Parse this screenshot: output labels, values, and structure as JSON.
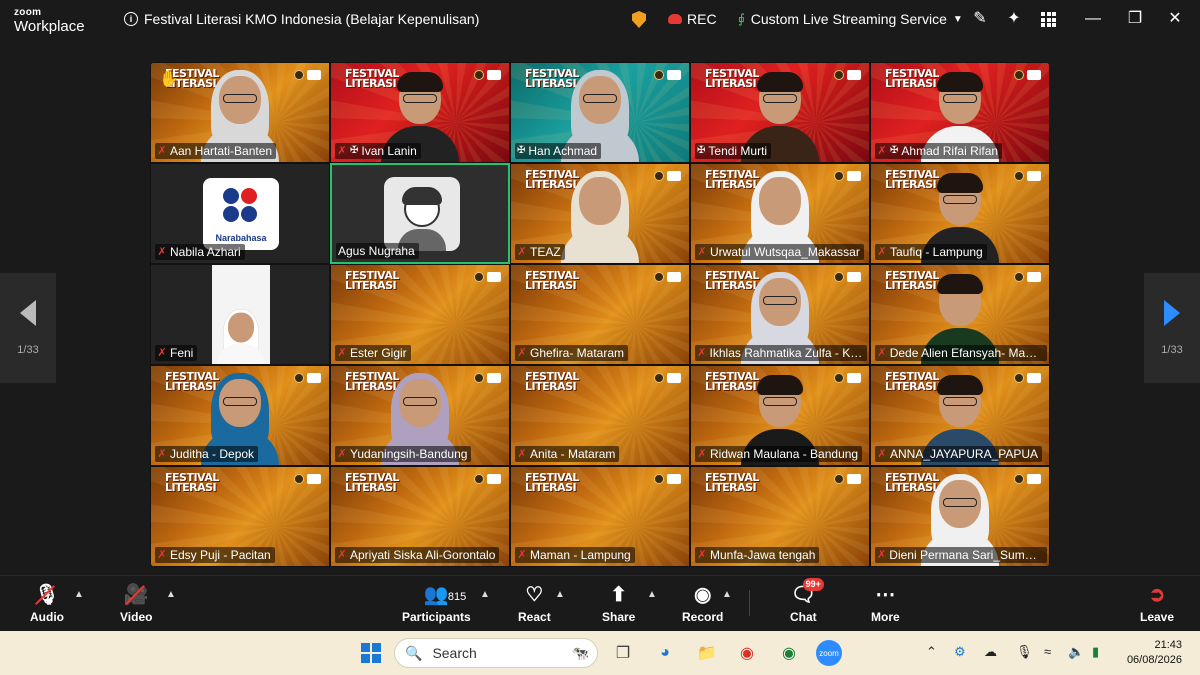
{
  "titlebar": {
    "brand_top": "zoom",
    "brand_bottom": "Workplace",
    "meeting_title": "Festival Literasi KMO Indonesia (Belajar Kepenulisan)",
    "rec_label": "REC",
    "stream_label": "Custom Live Streaming Service",
    "icons": [
      "info-icon",
      "shield-icon",
      "cloud-record-icon",
      "live-stream-icon",
      "annotate-icon",
      "sparkle-icon",
      "view-grid-icon"
    ],
    "window_controls": [
      "minimize",
      "maximize",
      "close"
    ]
  },
  "gallery": {
    "page_left": "1/33",
    "page_right": "1/33",
    "banner_line1": "FESTIVAL",
    "banner_line2": "LITERASI",
    "participants": [
      {
        "name": "Aan Hartati-Banten",
        "muted": true,
        "hand_raised": true
      },
      {
        "name": "Ivan Lanin",
        "muted": true,
        "pinned": true
      },
      {
        "name": "Han Achmad",
        "pinned": true
      },
      {
        "name": "Tendi Murti",
        "pinned": true
      },
      {
        "name": "Ahmad Rifai Rifan",
        "muted": true,
        "pinned": true
      },
      {
        "name": "Nabila Azhari",
        "muted": true,
        "logo_text": "Narabahasa"
      },
      {
        "name": "Agus Nugraha",
        "active_speaker": true
      },
      {
        "name": "TEAZ",
        "muted": true
      },
      {
        "name": "Urwatul Wutsqaa_Makassar",
        "muted": true
      },
      {
        "name": "Taufiq - Lampung",
        "muted": true
      },
      {
        "name": "Feni",
        "muted": true
      },
      {
        "name": "Ester Gigir",
        "muted": true
      },
      {
        "name": "Ghefira- Mataram",
        "muted": true
      },
      {
        "name": "Ikhlas Rahmatika Zulfa - Kot...",
        "muted": true
      },
      {
        "name": "Dede Alien Efansyah- Madiun",
        "muted": true
      },
      {
        "name": "Juditha - Depok",
        "muted": true
      },
      {
        "name": "Yudaningsih-Bandung",
        "muted": true
      },
      {
        "name": "Anita - Mataram",
        "muted": true
      },
      {
        "name": "Ridwan Maulana - Bandung",
        "muted": true
      },
      {
        "name": "ANNA_JAYAPURA_PAPUA",
        "muted": true
      },
      {
        "name": "Edsy Puji - Pacitan",
        "muted": true
      },
      {
        "name": "Apriyati Siska Ali-Gorontalo",
        "muted": true
      },
      {
        "name": "Maman - Lampung",
        "muted": true
      },
      {
        "name": "Munfa-Jawa tengah",
        "muted": true
      },
      {
        "name": "Dieni Permana Sari_Sumeda...",
        "muted": true
      }
    ]
  },
  "controls": {
    "audio": "Audio",
    "video": "Video",
    "participants": "Participants",
    "participants_count": "815",
    "react": "React",
    "share": "Share",
    "record": "Record",
    "chat": "Chat",
    "chat_badge": "99+",
    "more": "More",
    "leave": "Leave"
  },
  "taskbar": {
    "search_placeholder": "Search",
    "time": "21:43",
    "date": "06/08/2026"
  },
  "colors": {
    "accent_blue": "#2d8cff",
    "mute_red": "#e53935",
    "active_green": "#27c26a",
    "banner_orange": "#e0901a"
  }
}
